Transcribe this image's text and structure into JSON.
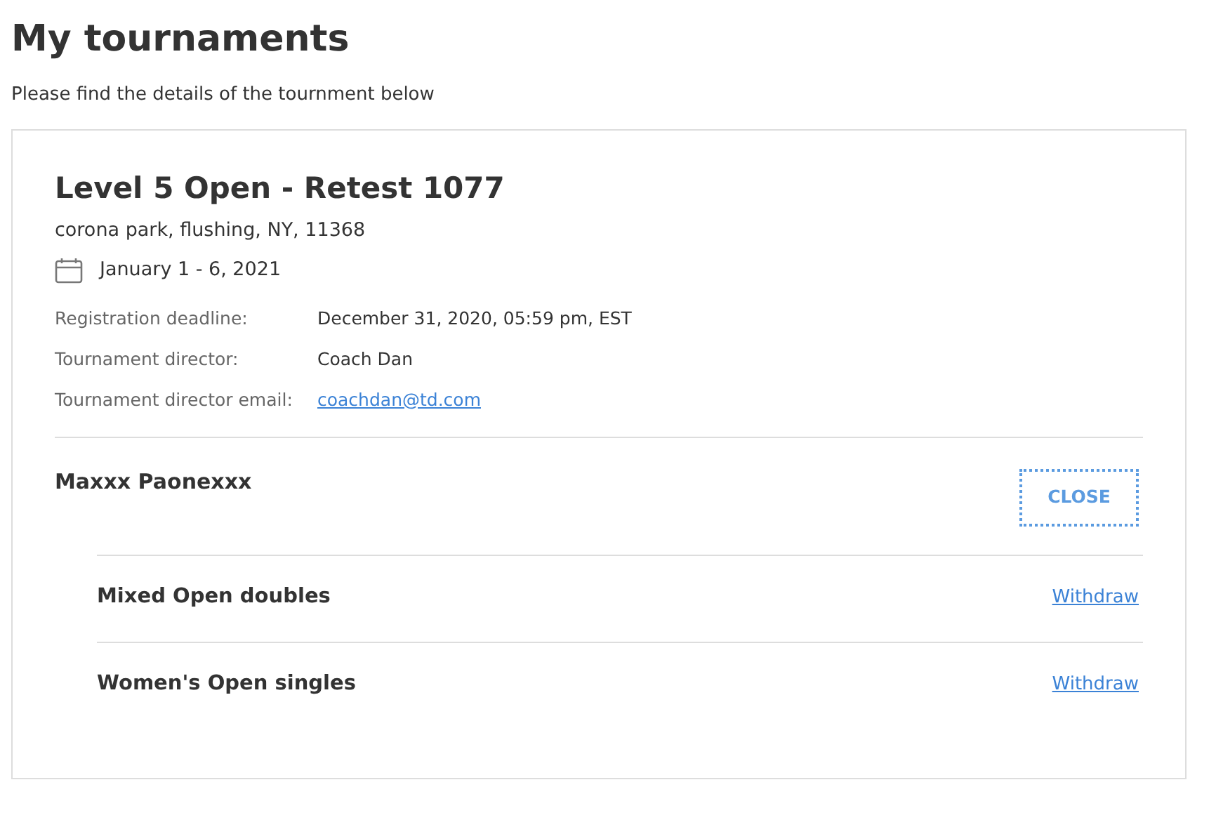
{
  "page": {
    "title": "My tournaments",
    "subtitle": "Please find the details of the tournment below"
  },
  "tournament": {
    "name": "Level 5 Open - Retest 1077",
    "location": "corona park, flushing, NY, 11368",
    "dates": "January 1 - 6, 2021",
    "details": [
      {
        "label": "Registration deadline:",
        "value": "December 31, 2020, 05:59 pm, EST",
        "kind": "text"
      },
      {
        "label": "Tournament director:",
        "value": "Coach Dan",
        "kind": "text"
      },
      {
        "label": "Tournament director email:",
        "value": "coachdan@td.com",
        "kind": "link"
      }
    ],
    "player": {
      "name": "Maxxx Paonexxx",
      "button": {
        "label": "CLOSE",
        "focused": true
      }
    },
    "events": [
      {
        "name": "Mixed Open doubles",
        "action": "Withdraw"
      },
      {
        "name": "Women's Open singles",
        "action": "Withdraw"
      }
    ]
  }
}
